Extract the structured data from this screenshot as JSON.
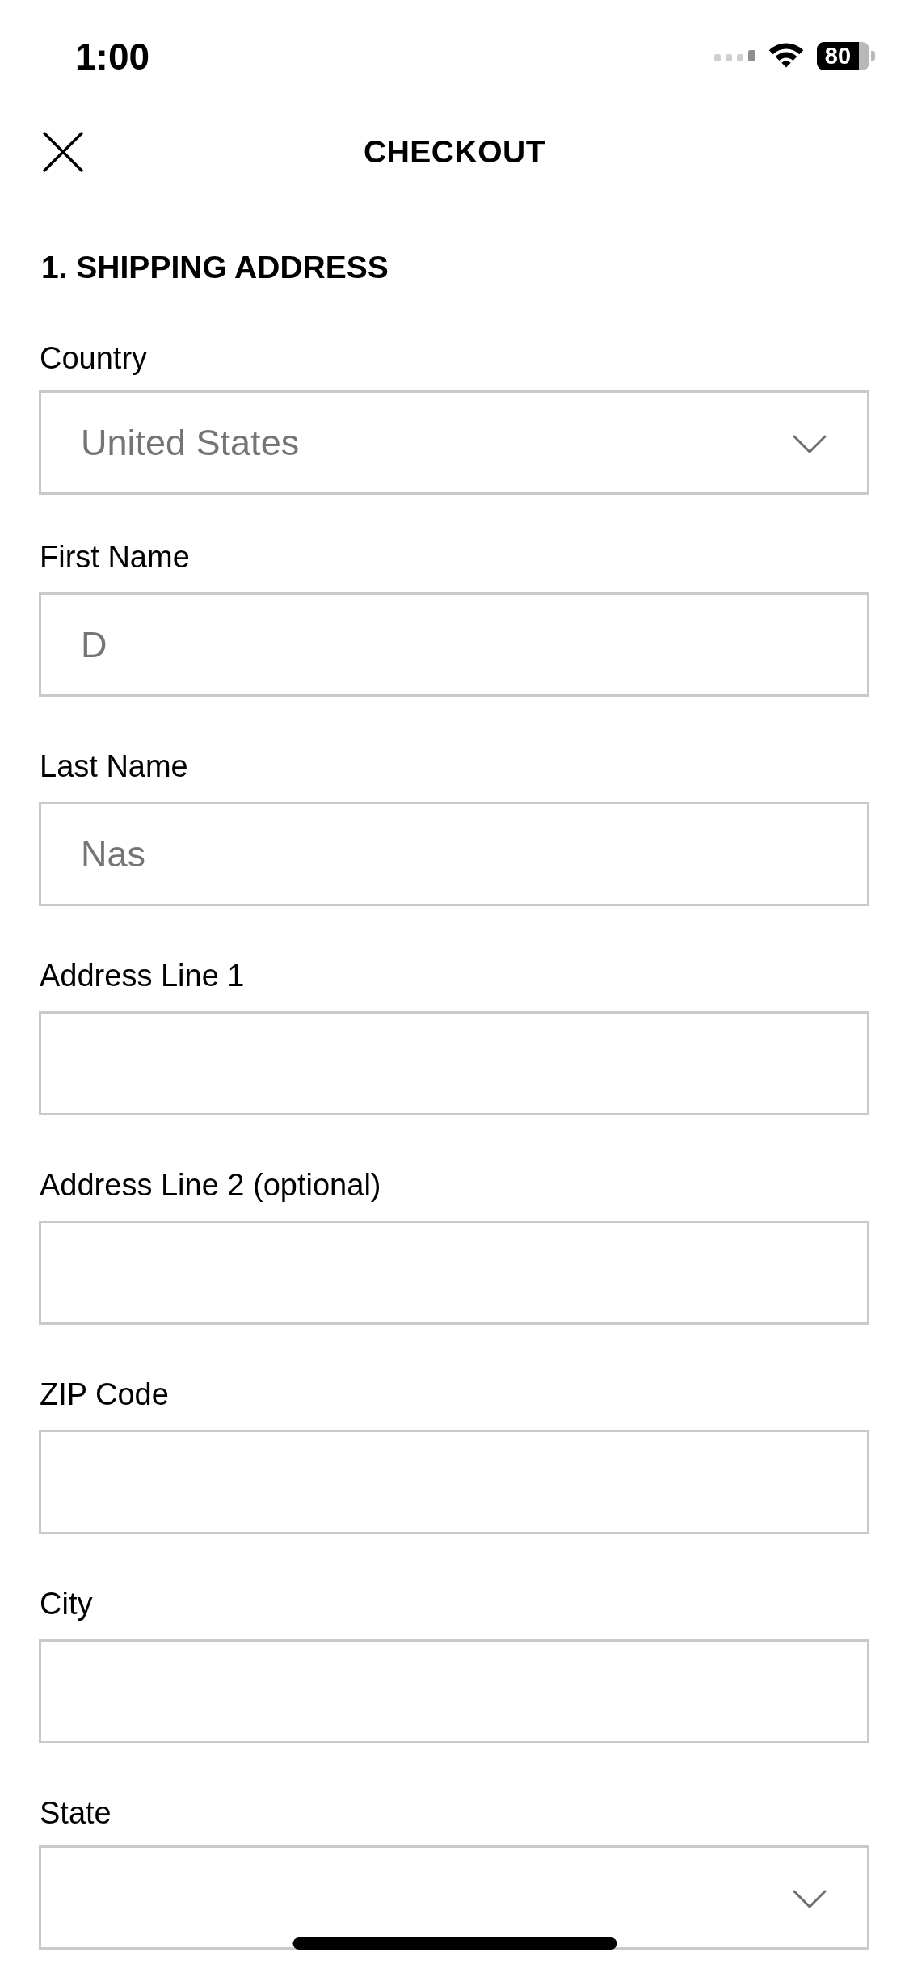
{
  "status_bar": {
    "time": "1:00",
    "battery": "80"
  },
  "header": {
    "title": "CHECKOUT"
  },
  "section": {
    "title": "1. SHIPPING ADDRESS"
  },
  "fields": [
    {
      "label": "Country",
      "kind": "select",
      "value": "United States"
    },
    {
      "label": "First Name",
      "kind": "text",
      "value": "D"
    },
    {
      "label": "Last Name",
      "kind": "text",
      "value": "Nas"
    },
    {
      "label": "Address Line 1",
      "kind": "text"
    },
    {
      "label": "Address Line 2 (optional)",
      "kind": "text"
    },
    {
      "label": "ZIP Code",
      "kind": "text"
    },
    {
      "label": "City",
      "kind": "text"
    },
    {
      "label": "State",
      "kind": "select"
    }
  ]
}
